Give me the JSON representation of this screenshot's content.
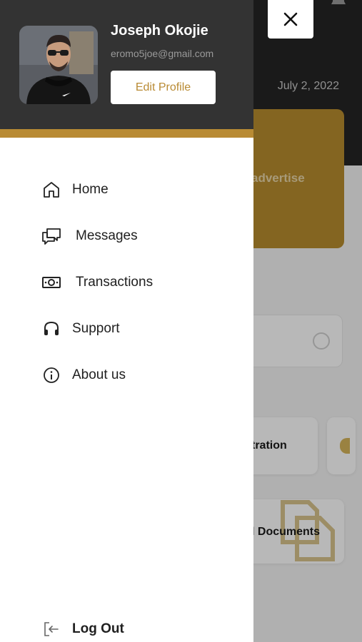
{
  "background": {
    "date": "July 2, 2022",
    "banner_text": "advertise",
    "card1_text": "tration",
    "card2_text": "l Documents"
  },
  "profile": {
    "name": "Joseph Okojie",
    "email": "eromo5joe@gmail.com",
    "edit_label": "Edit Profile"
  },
  "menu": {
    "items": [
      {
        "label": "Home",
        "icon": "home-icon"
      },
      {
        "label": "Messages",
        "icon": "messages-icon"
      },
      {
        "label": "Transactions",
        "icon": "cash-icon"
      },
      {
        "label": "Support",
        "icon": "headset-icon"
      },
      {
        "label": "About us",
        "icon": "info-icon"
      }
    ],
    "logout_label": "Log Out"
  },
  "colors": {
    "accent": "#b98b34",
    "header_bg": "#333333",
    "app_header_bg": "#242424"
  }
}
